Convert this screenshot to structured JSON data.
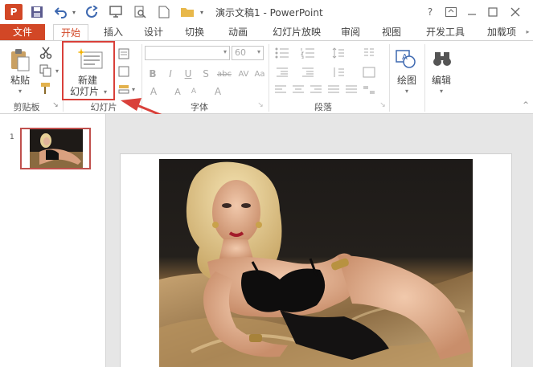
{
  "title_bar": {
    "app_logo": "P",
    "title": "演示文稿1 - PowerPoint",
    "help": "?",
    "icons": [
      "save-icon",
      "undo-icon",
      "redo-icon",
      "touch-mode-icon",
      "print-preview-icon",
      "new-icon",
      "open-folder-icon"
    ]
  },
  "tabs": [
    "文件",
    "开始",
    "插入",
    "设计",
    "切换",
    "动画",
    "幻灯片放映",
    "审阅",
    "视图",
    "开发工具",
    "加载项"
  ],
  "ribbon": {
    "clipboard": {
      "paste_label": "粘贴",
      "group_label": "剪贴板"
    },
    "slides": {
      "new_slide_line1": "新建",
      "new_slide_line2": "幻灯片",
      "group_label": "幻灯片"
    },
    "font": {
      "size_value": "60",
      "group_label": "字体"
    },
    "paragraph": {
      "group_label": "段落"
    },
    "drawing": {
      "label": "绘图"
    },
    "editing": {
      "label": "编辑"
    }
  },
  "thumbnail_pane": {
    "slide_number": "1"
  },
  "colors": {
    "accent": "#d24726",
    "highlight": "#d9403a"
  }
}
